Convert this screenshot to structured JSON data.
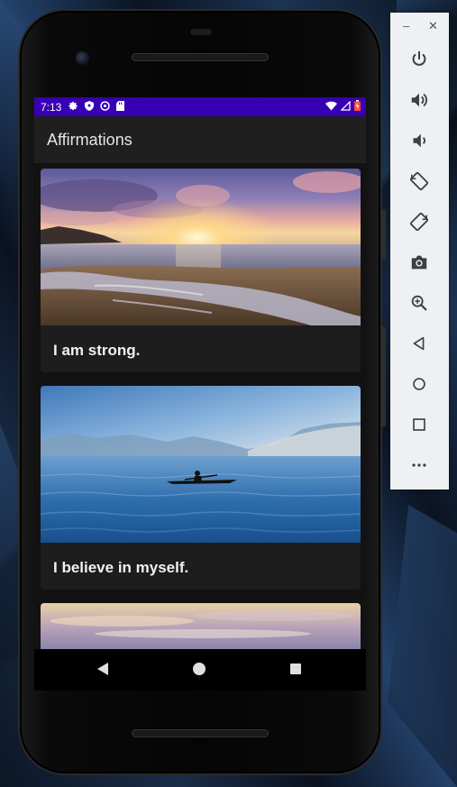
{
  "status_bar": {
    "time": "7:13",
    "background": "#3700b3",
    "left_icons": [
      "settings-icon",
      "shield-icon",
      "at-sign-icon",
      "sd-card-icon"
    ],
    "right_icons": [
      "wifi-icon",
      "cell-signal-icon",
      "battery-icon"
    ]
  },
  "app_bar": {
    "title": "Affirmations"
  },
  "cards": [
    {
      "label": "I am strong.",
      "image": "sunset-beach-image"
    },
    {
      "label": "I believe in myself.",
      "image": "lake-kayak-image"
    },
    {
      "label": "",
      "image": "cloudy-sky-image"
    }
  ],
  "navigation_bar": {
    "buttons": [
      "back-icon",
      "home-icon",
      "recents-icon"
    ]
  },
  "emulator_toolbar": {
    "window_controls": [
      "minimize-icon",
      "close-icon"
    ],
    "buttons": [
      "power-icon",
      "volume-up-icon",
      "volume-down-icon",
      "rotate-left-icon",
      "rotate-right-icon",
      "camera-icon",
      "zoom-icon",
      "back-icon",
      "home-icon",
      "overview-icon",
      "more-icon"
    ]
  },
  "colors": {
    "screen_background": "#121212",
    "app_bar": "#1f1f1f",
    "card_background": "#1d1d1d",
    "emulator_toolbar": "#eef0f3"
  }
}
